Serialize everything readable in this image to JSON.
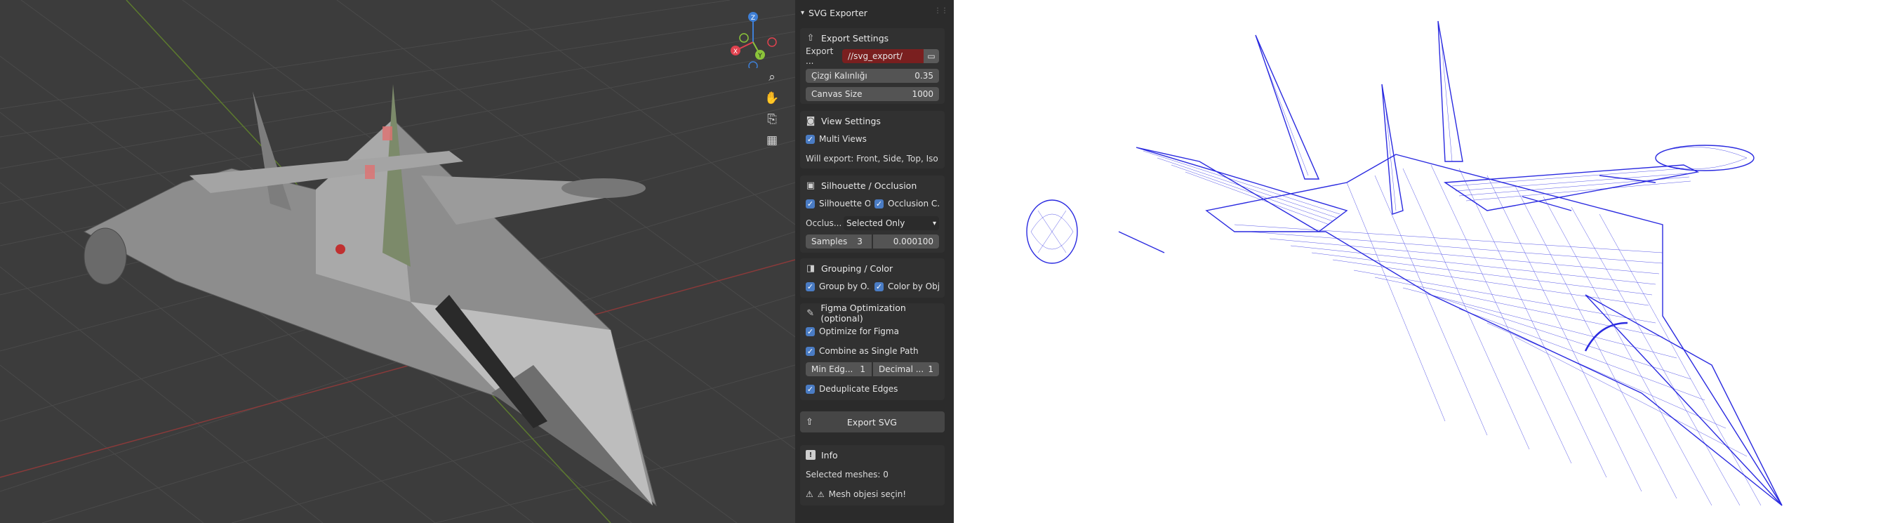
{
  "panel": {
    "title": "SVG Exporter",
    "export_settings": {
      "header": "Export Settings",
      "path_label": "Export ...",
      "path_value": "//svg_export/",
      "line_thickness_label": "Çizgi Kalınlığı",
      "line_thickness_value": "0.35",
      "canvas_size_label": "Canvas Size",
      "canvas_size_value": "1000"
    },
    "view_settings": {
      "header": "View Settings",
      "multi_views_label": "Multi Views",
      "will_export_text": "Will export: Front, Side, Top, Iso"
    },
    "silhouette": {
      "header": "Silhouette / Occlusion",
      "silhouette_label": "Silhouette O...",
      "occlusion_label": "Occlusion C...",
      "occlusion_mode_label": "Occlus...",
      "occlusion_mode_value": "Selected Only",
      "samples_label": "Samples",
      "samples_value": "3",
      "threshold_value": "0.000100"
    },
    "grouping": {
      "header": "Grouping / Color",
      "group_label": "Group by O...",
      "color_label": "Color by Obj..."
    },
    "figma": {
      "header": "Figma Optimization (optional)",
      "optimize_label": "Optimize for Figma",
      "combine_label": "Combine as Single Path",
      "min_edge_label": "Min Edg...",
      "min_edge_value": "1",
      "decimal_label": "Decimal ...",
      "decimal_value": "1",
      "dedupe_label": "Deduplicate Edges"
    },
    "export_button": "Export SVG",
    "info": {
      "header": "Info",
      "selected_meshes": "Selected meshes: 0",
      "warning": "Mesh objesi seçin!"
    }
  },
  "viewport": {
    "gizmo": {
      "x": "X",
      "y": "Y",
      "z": "Z"
    },
    "tools": [
      "zoom-icon",
      "hand-pan-icon",
      "camera-icon",
      "grid-view-icon"
    ]
  },
  "colors": {
    "accent_blue": "#4a7cc4",
    "path_field_red": "#7a1f1f",
    "wireframe_blue": "#2a2ae0",
    "axis_x": "#e0424f",
    "axis_y": "#8bc43a",
    "axis_z": "#3e7fd6"
  }
}
